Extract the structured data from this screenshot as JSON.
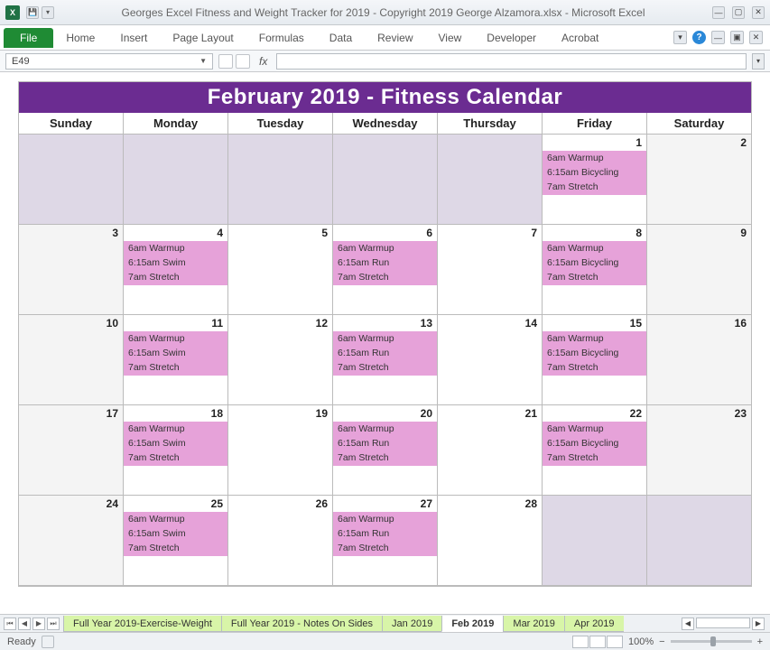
{
  "titlebar": {
    "title": "Georges Excel Fitness and Weight Tracker for 2019 - Copyright 2019 George Alzamora.xlsx  -  Microsoft Excel"
  },
  "menu": {
    "file": "File",
    "items": [
      "Home",
      "Insert",
      "Page Layout",
      "Formulas",
      "Data",
      "Review",
      "View",
      "Developer",
      "Acrobat"
    ]
  },
  "formulabar": {
    "cellref": "E49",
    "fx": "fx",
    "value": ""
  },
  "calendar": {
    "title": "February 2019  -  Fitness Calendar",
    "days": [
      "Sunday",
      "Monday",
      "Tuesday",
      "Wednesday",
      "Thursday",
      "Friday",
      "Saturday"
    ],
    "weeks": [
      [
        {
          "num": "",
          "out": true
        },
        {
          "num": "",
          "out": true
        },
        {
          "num": "",
          "out": true
        },
        {
          "num": "",
          "out": true
        },
        {
          "num": "",
          "out": true
        },
        {
          "num": "1",
          "events": [
            "6am Warmup",
            "6:15am Bicycling",
            "7am Stretch"
          ]
        },
        {
          "num": "2",
          "wk": true
        }
      ],
      [
        {
          "num": "3",
          "wk": true
        },
        {
          "num": "4",
          "events": [
            "6am Warmup",
            "6:15am Swim",
            "7am Stretch"
          ]
        },
        {
          "num": "5"
        },
        {
          "num": "6",
          "events": [
            "6am Warmup",
            "6:15am Run",
            "7am Stretch"
          ]
        },
        {
          "num": "7"
        },
        {
          "num": "8",
          "events": [
            "6am Warmup",
            "6:15am Bicycling",
            "7am Stretch"
          ]
        },
        {
          "num": "9",
          "wk": true
        }
      ],
      [
        {
          "num": "10",
          "wk": true
        },
        {
          "num": "11",
          "events": [
            "6am Warmup",
            "6:15am Swim",
            "7am Stretch"
          ]
        },
        {
          "num": "12"
        },
        {
          "num": "13",
          "events": [
            "6am Warmup",
            "6:15am Run",
            "7am Stretch"
          ]
        },
        {
          "num": "14"
        },
        {
          "num": "15",
          "events": [
            "6am Warmup",
            "6:15am Bicycling",
            "7am Stretch"
          ]
        },
        {
          "num": "16",
          "wk": true
        }
      ],
      [
        {
          "num": "17",
          "wk": true
        },
        {
          "num": "18",
          "events": [
            "6am Warmup",
            "6:15am Swim",
            "7am Stretch"
          ]
        },
        {
          "num": "19"
        },
        {
          "num": "20",
          "events": [
            "6am Warmup",
            "6:15am Run",
            "7am Stretch"
          ]
        },
        {
          "num": "21"
        },
        {
          "num": "22",
          "events": [
            "6am Warmup",
            "6:15am Bicycling",
            "7am Stretch"
          ]
        },
        {
          "num": "23",
          "wk": true
        }
      ],
      [
        {
          "num": "24",
          "wk": true
        },
        {
          "num": "25",
          "events": [
            "6am Warmup",
            "6:15am Swim",
            "7am Stretch"
          ]
        },
        {
          "num": "26"
        },
        {
          "num": "27",
          "events": [
            "6am Warmup",
            "6:15am Run",
            "7am Stretch"
          ]
        },
        {
          "num": "28"
        },
        {
          "num": "",
          "out": true
        },
        {
          "num": "",
          "out": true
        }
      ]
    ]
  },
  "tabs": {
    "list": [
      "Full Year 2019-Exercise-Weight",
      "Full Year 2019 - Notes On Sides",
      "Jan 2019",
      "Feb 2019",
      "Mar 2019",
      "Apr 2019"
    ],
    "active": 3
  },
  "statusbar": {
    "ready": "Ready",
    "zoom_pct": "100%"
  }
}
